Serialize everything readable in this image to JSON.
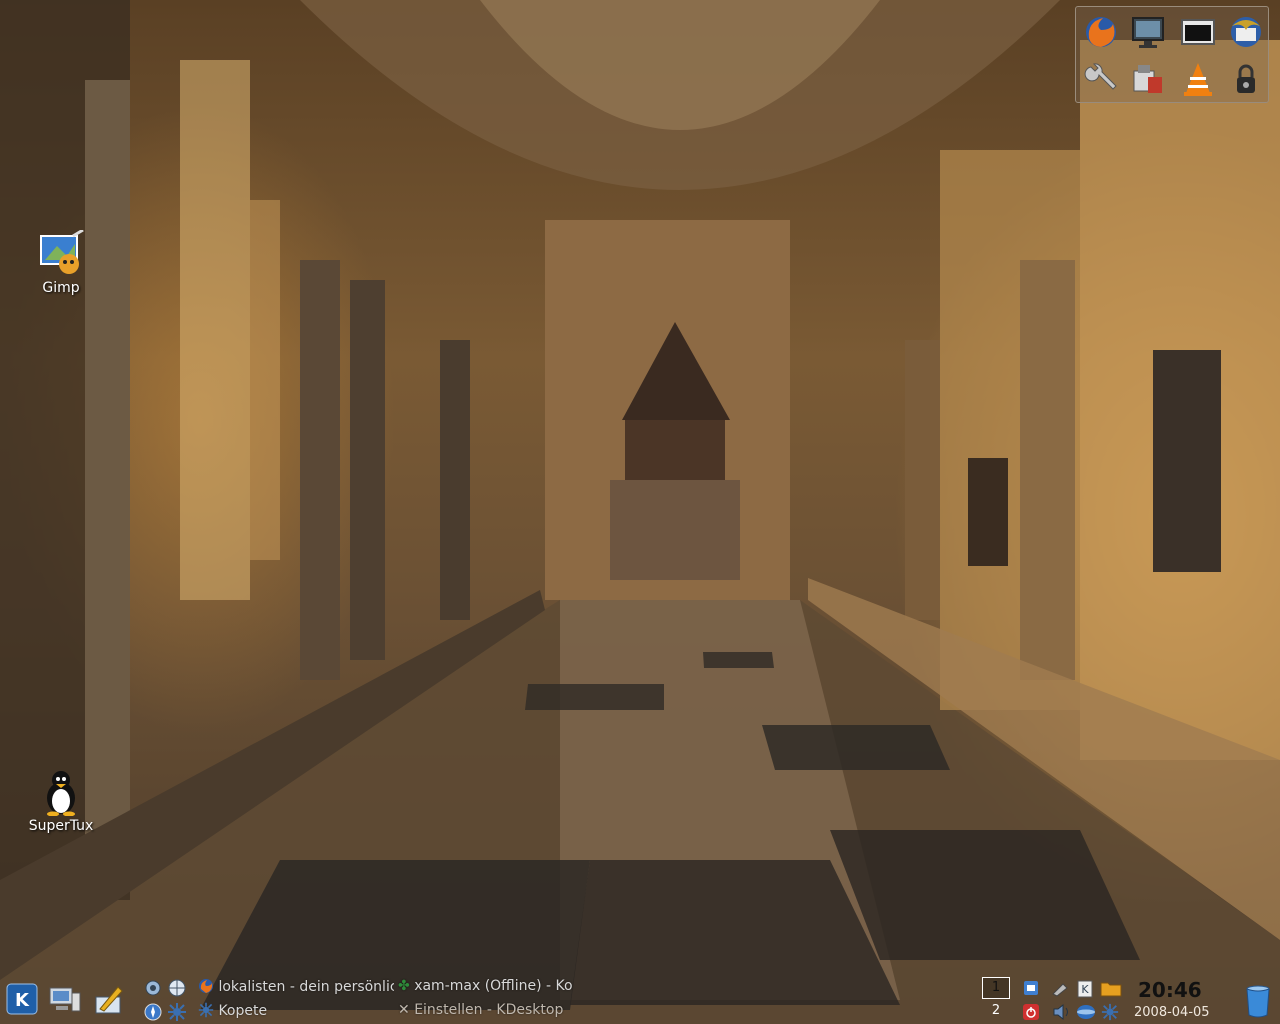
{
  "desktop": {
    "icons": [
      {
        "label": "Gimp",
        "icon": "gimp-icon"
      },
      {
        "label": "SuperTux",
        "icon": "tux-icon"
      }
    ]
  },
  "quick_launch": {
    "items": [
      {
        "icon": "firefox-icon"
      },
      {
        "icon": "monitor-icon"
      },
      {
        "icon": "terminal-icon"
      },
      {
        "icon": "thunderbird-icon"
      },
      {
        "icon": "wrench-icon"
      },
      {
        "icon": "package-icon"
      },
      {
        "icon": "vlc-icon"
      },
      {
        "icon": "padlock-icon"
      }
    ]
  },
  "taskbar": {
    "tasks": [
      {
        "label": "lokalisten - dein persönlic",
        "icon": "firefox-icon"
      },
      {
        "label": "xam-max (Offline) - Ko",
        "icon": "kopete-icon"
      },
      {
        "label": "Kopete",
        "icon": "kopete-icon"
      },
      {
        "label": "Einstellen - KDesktop",
        "icon": "x-icon"
      }
    ],
    "pager": [
      "1",
      "2"
    ],
    "clock": {
      "time": "20:46",
      "date": "2008-04-05"
    }
  },
  "colors": {
    "accent": "#1f5fa8",
    "panel_text": "#d8d8d8"
  }
}
